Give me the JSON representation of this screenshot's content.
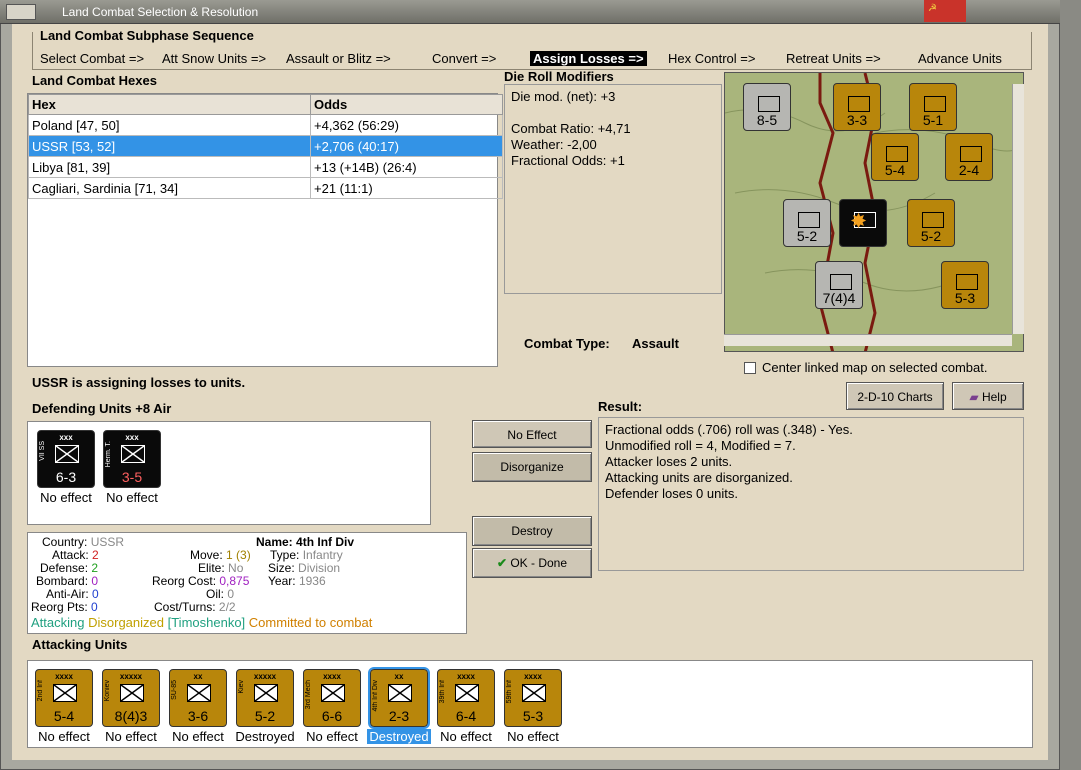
{
  "window": {
    "title": "Land Combat Selection & Resolution"
  },
  "subphase": {
    "title": "Land Combat Subphase Sequence",
    "items": [
      {
        "label": "Select Combat =>",
        "active": false
      },
      {
        "label": "Att Snow Units =>",
        "active": false
      },
      {
        "label": "Assault or Blitz =>",
        "active": false
      },
      {
        "label": "Convert =>",
        "active": false
      },
      {
        "label": "Assign Losses =>",
        "active": true
      },
      {
        "label": "Hex Control =>",
        "active": false
      },
      {
        "label": "Retreat Units =>",
        "active": false
      },
      {
        "label": "Advance Units",
        "active": false
      }
    ]
  },
  "hexes": {
    "title": "Land Combat Hexes",
    "columns": [
      "Hex",
      "Odds"
    ],
    "rows": [
      {
        "hex": "Poland [47, 50]",
        "odds": "+4,362 (56:29)",
        "selected": false
      },
      {
        "hex": "USSR [53, 52]",
        "odds": "+2,706 (40:17)",
        "selected": true
      },
      {
        "hex": "Libya [81, 39]",
        "odds": "+13 (+14B) (26:4)",
        "selected": false
      },
      {
        "hex": "Cagliari, Sardinia [71, 34]",
        "odds": "+21 (11:1)",
        "selected": false
      }
    ]
  },
  "modifiers": {
    "title": "Die Roll Modifiers",
    "lines": [
      "Die mod. (net): +3",
      "",
      "Combat Ratio: +4,71",
      "Weather: -2,00",
      "Fractional Odds: +1"
    ]
  },
  "combat_type": {
    "label": "Combat Type:",
    "value": "Assault"
  },
  "center_map": {
    "label": "Center linked map on selected combat."
  },
  "charts_button": "2-D-10 Charts",
  "help_button": "Help",
  "status_message": "USSR is assigning losses to units.",
  "defending": {
    "title": "Defending Units +8 Air",
    "units": [
      {
        "side": "VII SS",
        "size": "xxx",
        "value": "6-3",
        "label": "No effect",
        "value_color": "#ffffff"
      },
      {
        "side": "Herm. T.",
        "size": "xxx",
        "value": "3-5",
        "label": "No effect",
        "value_color": "#ff6060"
      }
    ]
  },
  "actions": {
    "no_effect": "No Effect",
    "disorganize": "Disorganize",
    "destroy": "Destroy",
    "ok_done": "OK - Done"
  },
  "result": {
    "title": "Result:",
    "lines": [
      "Fractional odds (.706) roll was (.348)  - Yes.",
      "Unmodified roll = 4, Modified = 7.",
      "Attacker loses 2 units.",
      "Attacking units are disorganized.",
      "Defender loses 0 units."
    ]
  },
  "unit_info": {
    "country_label": "Country:",
    "country": "USSR",
    "attack_label": "Attack:",
    "attack": "2",
    "defense_label": "Defense:",
    "defense": "2",
    "bombard_label": "Bombard:",
    "bombard": "0",
    "antiair_label": "Anti-Air:",
    "antiair": "0",
    "reorg_pts_label": "Reorg Pts:",
    "reorg_pts": "0",
    "name_label": "Name:",
    "name": "4th Inf Div",
    "move_label": "Move:",
    "move": "1 (3)",
    "elite_label": "Elite:",
    "elite": "No",
    "reorg_cost_label": "Reorg Cost:",
    "reorg_cost": "0,875",
    "oil_label": "Oil:",
    "oil": "0",
    "cost_turns_label": "Cost/Turns:",
    "cost_turns": "2/2",
    "type_label": "Type:",
    "type": "Infantry",
    "size_label": "Size:",
    "size": "Division",
    "year_label": "Year:",
    "year": "1936",
    "status_attacking": "Attacking",
    "status_disorganized": "Disorganized",
    "status_commander": "[Timoshenko]",
    "status_committed": "Committed to combat"
  },
  "attacking": {
    "title": "Attacking Units",
    "units": [
      {
        "side": "2nd Inf",
        "size": "xxxx",
        "value": "5-4",
        "label": "No effect",
        "selected": false,
        "symbol": "inf"
      },
      {
        "side": "Koniev",
        "size": "xxxxx",
        "value": "8(4)3",
        "label": "No effect",
        "selected": false,
        "symbol": "inf"
      },
      {
        "side": "SU-85",
        "size": "xx",
        "value": "3-6",
        "label": "No effect",
        "selected": false,
        "symbol": "arm"
      },
      {
        "side": "Kiev",
        "size": "xxxxx",
        "value": "5-2",
        "label": "Destroyed",
        "selected": false,
        "symbol": "mtn"
      },
      {
        "side": "3rd Mech",
        "size": "xxxx",
        "value": "6-6",
        "label": "No effect",
        "selected": false,
        "symbol": "mech"
      },
      {
        "side": "4th Inf Div",
        "size": "xx",
        "value": "2-3",
        "label": "Destroyed",
        "selected": true,
        "symbol": "inf"
      },
      {
        "side": "39th Inf",
        "size": "xxxx",
        "value": "6-4",
        "label": "No effect",
        "selected": false,
        "symbol": "inf"
      },
      {
        "side": "59th Inf",
        "size": "xxxx",
        "value": "5-3",
        "label": "No effect",
        "selected": false,
        "symbol": "inf"
      }
    ]
  },
  "map_counters": [
    {
      "value": "8-5",
      "color": "gray"
    },
    {
      "value": "3-3",
      "color": "gold"
    },
    {
      "value": "5-1",
      "color": "gold"
    },
    {
      "value": "5-4",
      "color": "gold"
    },
    {
      "value": "2-4",
      "color": "gold"
    },
    {
      "value": "5-2",
      "color": "gray"
    },
    {
      "value": "5-2",
      "color": "gold"
    },
    {
      "value": "7(4)4",
      "color": "gray"
    },
    {
      "value": "5-3",
      "color": "gold"
    }
  ]
}
